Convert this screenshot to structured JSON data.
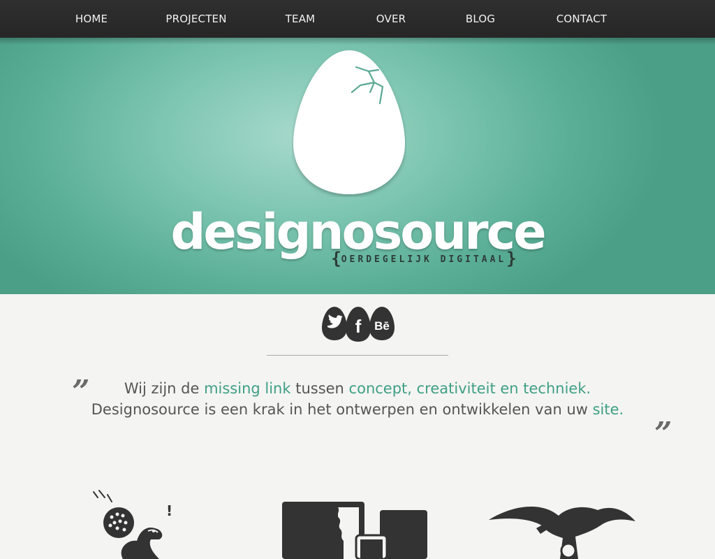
{
  "nav": {
    "items": [
      "HOME",
      "PROJECTEN",
      "TEAM",
      "OVER",
      "BLOG",
      "CONTACT"
    ]
  },
  "hero": {
    "brand": "designosource",
    "tagline": "OERDEGELIJK DIGITAAL"
  },
  "social": {
    "icons": [
      "twitter-icon",
      "facebook-icon",
      "behance-icon"
    ],
    "behance_label": "Bē",
    "facebook_label": "f"
  },
  "quote": {
    "line1_a": "Wij zijn de ",
    "line1_b": "missing link",
    "line1_c": " tussen ",
    "line1_d": "concept, creativiteit en techniek.",
    "line2_a": "Designosource is een krak in het ontwerpen en ontwikkelen van uw ",
    "line2_b": "site.",
    "open_mark": "„",
    "close_mark": "„"
  },
  "colors": {
    "accent": "#3f9f84",
    "nav_bg": "#2b2b2b",
    "hero_light": "#a6d9cb",
    "hero_dark": "#4c9f87",
    "icon_dark": "#333333"
  },
  "illustrations": [
    "dino-with-egg-illustration",
    "devices-illustration",
    "pterodactyl-illustration"
  ],
  "illustration_text": {
    "exclaim": "!"
  }
}
